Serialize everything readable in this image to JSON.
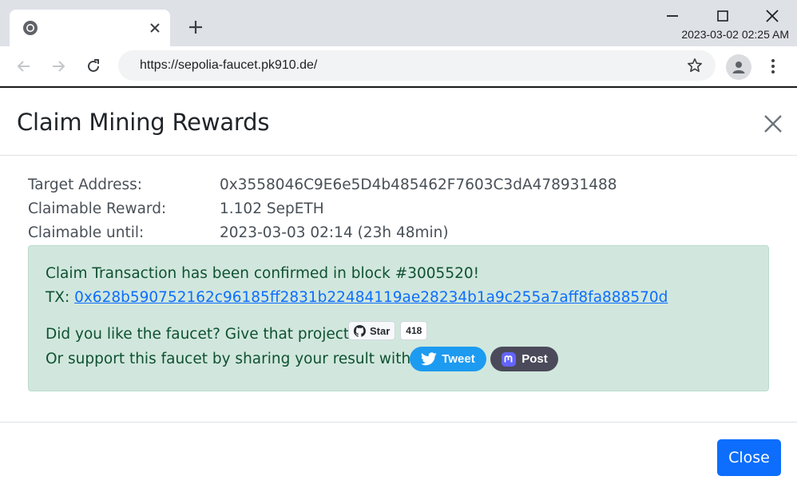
{
  "browser": {
    "clock": "2023-03-02 02:25 AM",
    "url": "https://sepolia-faucet.pk910.de/"
  },
  "modal": {
    "title": "Claim Mining Rewards",
    "fields": [
      {
        "label": "Target Address:",
        "value": "0x3558046C9E6e5D4b485462F7603C3dA478931488"
      },
      {
        "label": "Claimable Reward:",
        "value": "1.102 SepETH"
      },
      {
        "label": "Claimable until:",
        "value": "2023-03-03 02:14 (23h 48min)"
      }
    ],
    "alert": {
      "confirmed": "Claim Transaction has been confirmed in block #3005520!",
      "tx_prefix": "TX: ",
      "tx_hash": "0x628b590752162c96185ff2831b22484119ae28234b1a9c255a7aff8fa888570d",
      "like_text": "Did you like the faucet? Give that project a",
      "star_label": "Star",
      "star_count": "418",
      "share_text": "Or support this faucet by sharing your result with a",
      "tweet_label": "Tweet",
      "post_label": "Post"
    },
    "close_label": "Close"
  },
  "colors": {
    "primary": "#0d6efd",
    "alert_bg": "#d1e7dd",
    "alert_text": "#0f5132",
    "twitter": "#1d9bf0",
    "mastodon": "#4b4a5a"
  }
}
